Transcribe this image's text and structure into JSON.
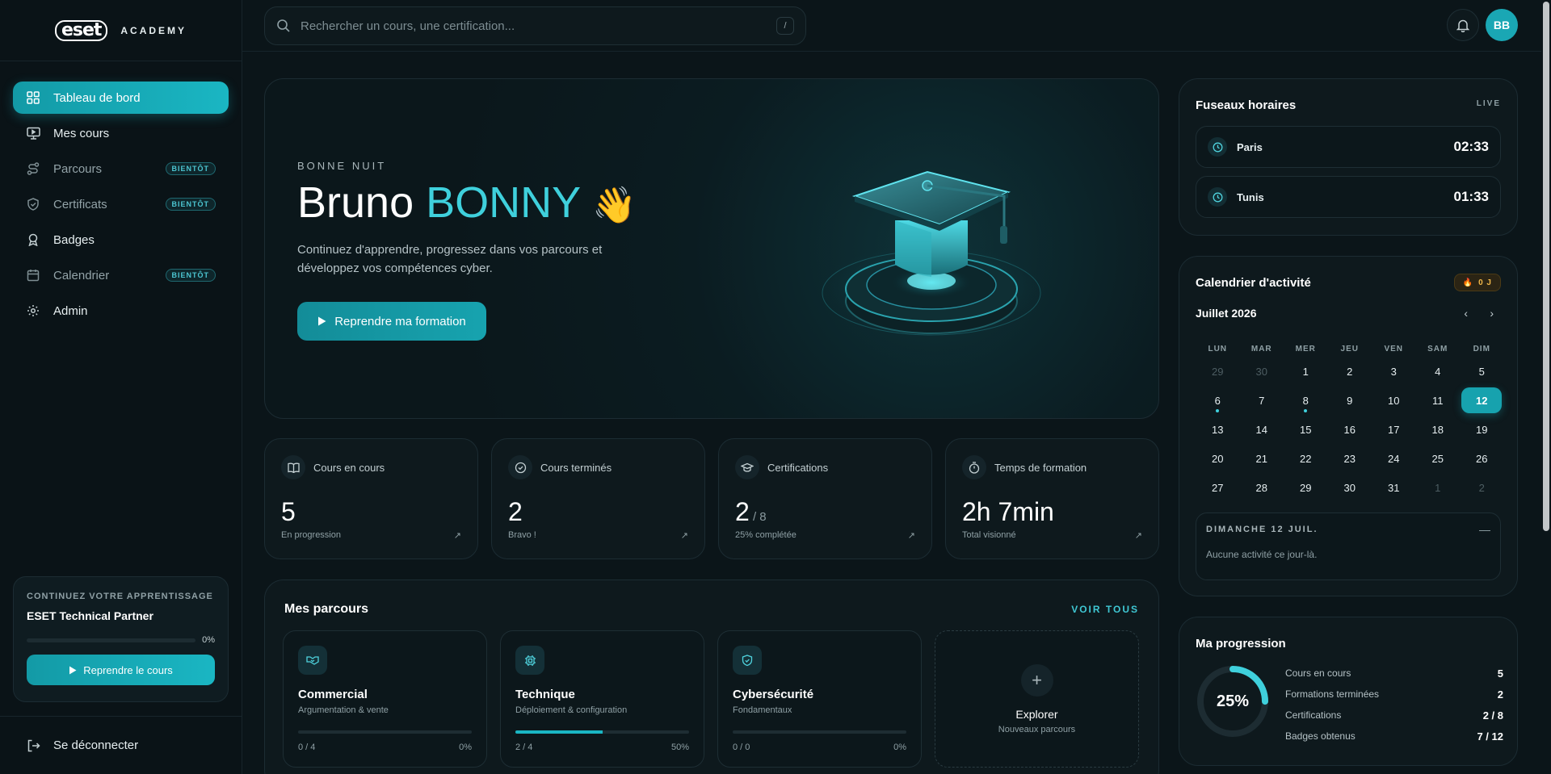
{
  "brand": {
    "mark": "eset",
    "name": "ACADEMY"
  },
  "search": {
    "placeholder": "Rechercher un cours, une certification...",
    "shortcut": "/"
  },
  "user": {
    "initials": "BB"
  },
  "sidebar": {
    "items": [
      {
        "label": "Tableau de bord",
        "icon": "grid-icon",
        "active": true
      },
      {
        "label": "Mes cours",
        "icon": "monitor-icon"
      },
      {
        "label": "Parcours",
        "icon": "route-icon",
        "badge": "BIENTÔT"
      },
      {
        "label": "Certificats",
        "icon": "shield-check-icon",
        "badge": "BIENTÔT"
      },
      {
        "label": "Badges",
        "icon": "ribbon-icon"
      },
      {
        "label": "Calendrier",
        "icon": "calendar-icon",
        "badge": "BIENTÔT"
      },
      {
        "label": "Admin",
        "icon": "gear-icon"
      }
    ],
    "continue_card": {
      "kicker": "CONTINUEZ VOTRE APPRENTISSAGE",
      "title": "ESET Technical Partner",
      "progress": 0,
      "progress_label": "0%",
      "button": "Reprendre le cours"
    },
    "logout": "Se déconnecter"
  },
  "hero": {
    "kicker": "BONNE NUIT",
    "first_name": "Bruno",
    "last_name": "BONNY",
    "wave": "👋",
    "description": "Continuez d'apprendre, progressez dans vos parcours et développez vos compétences cyber.",
    "button": "Reprendre ma formation"
  },
  "stats": [
    {
      "label": "Cours en cours",
      "value": "5",
      "sub": "",
      "foot": "En progression",
      "icon": "book-icon"
    },
    {
      "label": "Cours terminés",
      "value": "2",
      "sub": "",
      "foot": "Bravo !",
      "icon": "check-circle-icon"
    },
    {
      "label": "Certifications",
      "value": "2",
      "sub": " / 8",
      "foot": "25% complétée",
      "icon": "graduation-cap-icon"
    },
    {
      "label": "Temps de formation",
      "value": "2h 7min",
      "sub": "",
      "foot": "Total visionné",
      "icon": "stopwatch-icon"
    }
  ],
  "parcours": {
    "title": "Mes parcours",
    "see_all": "VOIR TOUS",
    "cards": [
      {
        "title": "Commercial",
        "sub": "Argumentation & vente",
        "count": "0 / 4",
        "pct_label": "0%",
        "progress": 0,
        "icon": "handshake-icon"
      },
      {
        "title": "Technique",
        "sub": "Déploiement & configuration",
        "count": "2 / 4",
        "pct_label": "50%",
        "progress": 0.5,
        "icon": "chip-icon"
      },
      {
        "title": "Cybersécurité",
        "sub": "Fondamentaux",
        "count": "0 / 0",
        "pct_label": "0%",
        "progress": 0,
        "icon": "shield-icon"
      }
    ],
    "explore": {
      "title": "Explorer",
      "sub": "Nouveaux parcours"
    }
  },
  "timezones": {
    "title": "Fuseaux horaires",
    "status": "LIVE",
    "items": [
      {
        "city": "Paris",
        "time": "02:33"
      },
      {
        "city": "Tunis",
        "time": "01:33"
      }
    ]
  },
  "calendar": {
    "title": "Calendrier d'activité",
    "streak": "0 J",
    "month": "Juillet 2026",
    "weekdays": [
      "LUN",
      "MAR",
      "MER",
      "JEU",
      "VEN",
      "SAM",
      "DIM"
    ],
    "weeks": [
      [
        {
          "d": "29",
          "m": true
        },
        {
          "d": "30",
          "m": true
        },
        {
          "d": "1"
        },
        {
          "d": "2"
        },
        {
          "d": "3"
        },
        {
          "d": "4"
        },
        {
          "d": "5"
        }
      ],
      [
        {
          "d": "6",
          "dot": true
        },
        {
          "d": "7"
        },
        {
          "d": "8",
          "dot": true
        },
        {
          "d": "9"
        },
        {
          "d": "10"
        },
        {
          "d": "11"
        },
        {
          "d": "12",
          "today": true
        }
      ],
      [
        {
          "d": "13"
        },
        {
          "d": "14"
        },
        {
          "d": "15"
        },
        {
          "d": "16"
        },
        {
          "d": "17"
        },
        {
          "d": "18"
        },
        {
          "d": "19"
        }
      ],
      [
        {
          "d": "20"
        },
        {
          "d": "21"
        },
        {
          "d": "22"
        },
        {
          "d": "23"
        },
        {
          "d": "24"
        },
        {
          "d": "25"
        },
        {
          "d": "26"
        }
      ],
      [
        {
          "d": "27"
        },
        {
          "d": "28"
        },
        {
          "d": "29"
        },
        {
          "d": "30"
        },
        {
          "d": "31"
        },
        {
          "d": "1",
          "m": true
        },
        {
          "d": "2",
          "m": true
        }
      ]
    ],
    "detail": {
      "date": "DIMANCHE 12 JUIL.",
      "text": "Aucune activité ce jour-là."
    }
  },
  "progress": {
    "title": "Ma progression",
    "percent": 25,
    "percent_label": "25%",
    "rows": [
      {
        "label": "Cours en cours",
        "value": "5"
      },
      {
        "label": "Formations terminées",
        "value": "2"
      },
      {
        "label": "Certifications",
        "value": "2 / 8"
      },
      {
        "label": "Badges obtenus",
        "value": "7 / 12"
      }
    ]
  },
  "colors": {
    "accent": "#1ab6c3",
    "highlight": "#3fd0dc",
    "background": "#0b1519",
    "card": "#0e191d"
  }
}
